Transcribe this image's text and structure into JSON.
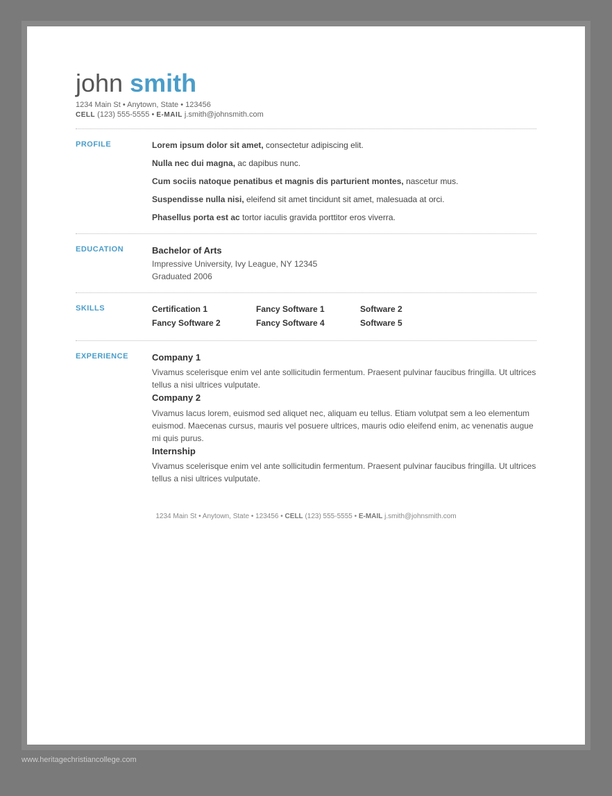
{
  "header": {
    "name_first": "john",
    "name_last": "smith",
    "address": "1234 Main St • Anytown, State • 123456",
    "cell_label": "CELL",
    "cell": "(123) 555-5555",
    "email_label": "E-MAIL",
    "email": "j.smith@johnsmith.com"
  },
  "sections": {
    "profile": {
      "label": "PROFILE",
      "paragraphs": [
        {
          "bold": "Lorem ipsum dolor sit amet,",
          "normal": " consectetur adipiscing elit."
        },
        {
          "bold": "Nulla nec dui magna,",
          "normal": " ac dapibus nunc."
        },
        {
          "bold": "Cum sociis natoque penatibus et magnis dis parturient montes,",
          "normal": " nascetur mus."
        },
        {
          "bold": "Suspendisse nulla nisi,",
          "normal": " eleifend sit amet tincidunt sit amet, malesuada at orci."
        },
        {
          "bold": "Phasellus porta est ac",
          "normal": " tortor iaculis gravida porttitor eros viverra."
        }
      ]
    },
    "education": {
      "label": "EDUCATION",
      "degree": "Bachelor of Arts",
      "university": "Impressive University, Ivy League, NY 12345",
      "graduated": "Graduated 2006"
    },
    "skills": {
      "label": "SKILLS",
      "rows": [
        [
          "Certification 1",
          "Fancy Software 1",
          "Software 2"
        ],
        [
          "Fancy Software 2",
          "Fancy Software 4",
          "Software 5"
        ]
      ]
    },
    "experience": {
      "label": "EXPERIENCE",
      "entries": [
        {
          "company": "Company 1",
          "description": "Vivamus scelerisque enim vel ante sollicitudin fermentum. Praesent pulvinar faucibus fringilla. Ut ultrices tellus a nisi ultrices vulputate."
        },
        {
          "company": "Company 2",
          "description": "Vivamus lacus lorem, euismod sed aliquet nec, aliquam eu tellus. Etiam volutpat sem a leo elementum euismod. Maecenas cursus, mauris vel posuere ultrices, mauris odio eleifend enim, ac venenatis augue mi quis purus."
        },
        {
          "company": "Internship",
          "description": "Vivamus scelerisque enim vel ante sollicitudin fermentum. Praesent pulvinar faucibus fringilla. Ut ultrices tellus a nisi ultrices vulputate."
        }
      ]
    }
  },
  "footer": {
    "address": "1234 Main St • Anytown, State • 123456",
    "cell_label": "CELL",
    "cell": "(123) 555-5555",
    "email_label": "E-MAIL",
    "email": "j.smith@johnsmith.com"
  },
  "watermark": {
    "url": "www.heritagechristiancollege.com"
  }
}
